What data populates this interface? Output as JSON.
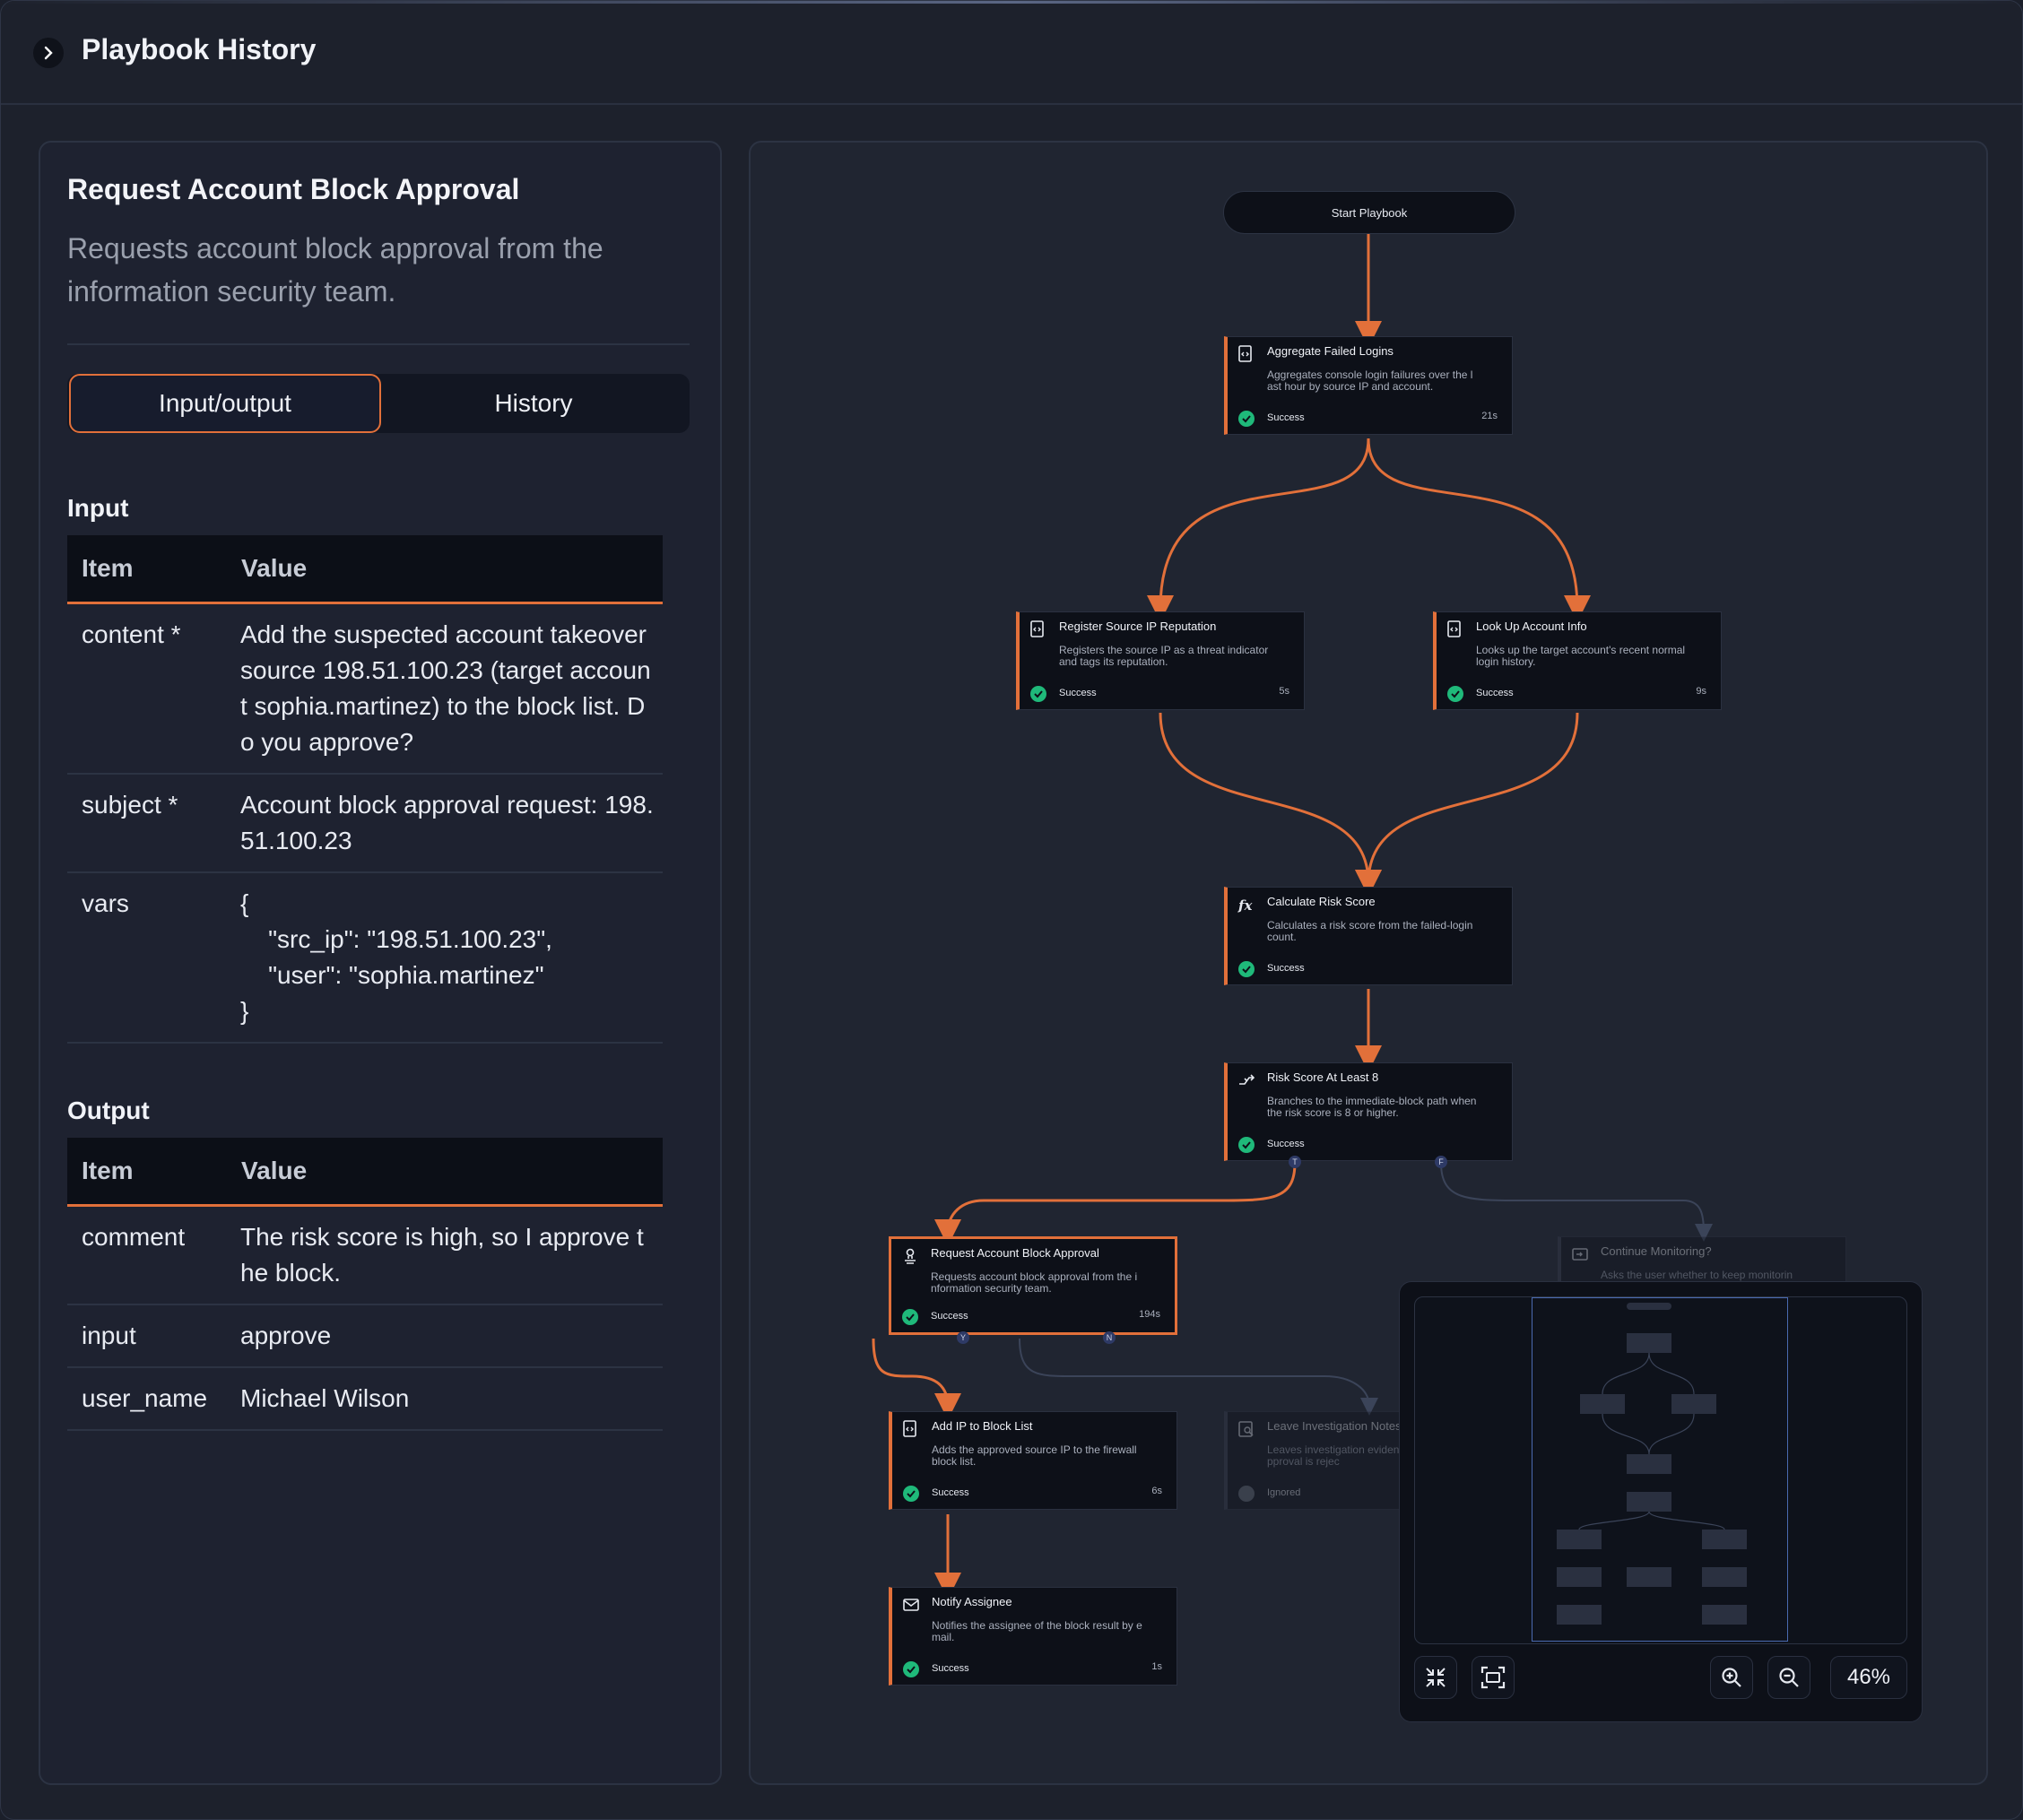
{
  "header": {
    "title": "Playbook History"
  },
  "detail": {
    "title": "Request Account Block Approval",
    "description": "Requests account block approval from the information security team.",
    "tabs": [
      {
        "label": "Input/output",
        "active": true
      },
      {
        "label": "History",
        "active": false
      }
    ],
    "input": {
      "section_title": "Input",
      "columns": [
        "Item",
        "Value"
      ],
      "rows": [
        {
          "item": "content *",
          "value": "Add the suspected account takeover source 198.51.100.23 (target account sophia.martinez) to the block list. Do you approve?"
        },
        {
          "item": "subject *",
          "value": "Account block approval request: 198.51.100.23"
        },
        {
          "item": "vars",
          "value": "{\n    \"src_ip\": \"198.51.100.23\",\n    \"user\": \"sophia.martinez\"\n}"
        }
      ]
    },
    "output": {
      "section_title": "Output",
      "columns": [
        "Item",
        "Value"
      ],
      "rows": [
        {
          "item": "comment",
          "value": "The risk score is high, so I approve the block."
        },
        {
          "item": "input",
          "value": "approve"
        },
        {
          "item": "user_name",
          "value": "Michael Wilson"
        }
      ]
    }
  },
  "flow": {
    "start_label": "Start Playbook",
    "nodes": [
      {
        "id": "agg",
        "icon": "script-icon",
        "title": "Aggregate Failed Logins",
        "desc": "Aggregates console login failures over the last hour by source IP and account.",
        "status": "Success",
        "time": "21s"
      },
      {
        "id": "reg",
        "icon": "script-icon",
        "title": "Register Source IP Reputation",
        "desc": "Registers the source IP as a threat indicator and tags its reputation.",
        "status": "Success",
        "time": "5s"
      },
      {
        "id": "look",
        "icon": "script-icon",
        "title": "Look Up Account Info",
        "desc": "Looks up the target account's recent normal login history.",
        "status": "Success",
        "time": "9s"
      },
      {
        "id": "calc",
        "icon": "function-icon",
        "title": "Calculate Risk Score",
        "desc": "Calculates a risk score from the failed-login count.",
        "status": "Success",
        "time": ""
      },
      {
        "id": "cond",
        "icon": "branch-icon",
        "title": "Risk Score At Least 8",
        "desc": "Branches to the immediate-block path when the risk score is 8 or higher.",
        "status": "Success",
        "time": ""
      },
      {
        "id": "req",
        "icon": "approval-icon",
        "title": "Request Account Block Approval",
        "desc": "Requests account block approval from the information security team.",
        "status": "Success",
        "time": "194s"
      },
      {
        "id": "cont",
        "icon": "prompt-icon",
        "title": "Continue Monitoring?",
        "desc": "Asks the user whether to keep monitorin",
        "status": "",
        "time": ""
      },
      {
        "id": "addip",
        "icon": "script-icon",
        "title": "Add IP to Block List",
        "desc": "Adds the approved source IP to the firewall block list.",
        "status": "Success",
        "time": "6s"
      },
      {
        "id": "leave",
        "icon": "note-icon",
        "title": "Leave Investigation Notes",
        "desc": "Leaves investigation evidence ticket when approval is rejec",
        "status": "Ignored",
        "time": ""
      },
      {
        "id": "notify",
        "icon": "mail-icon",
        "title": "Notify Assignee",
        "desc": "Notifies the assignee of the block result by email.",
        "status": "Success",
        "time": "1s"
      }
    ],
    "ports": {
      "true": "T",
      "false": "F",
      "yes": "Y",
      "no": "N"
    },
    "colors": {
      "accent": "#e2703a",
      "success": "#1fb97a",
      "dim_edge": "#3b4459"
    }
  },
  "minimap": {
    "zoom_label": "46%"
  }
}
